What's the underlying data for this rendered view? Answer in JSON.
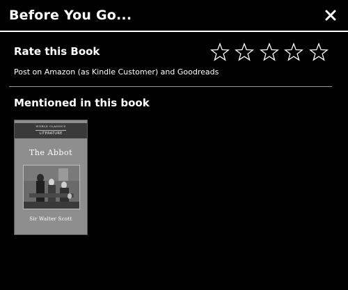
{
  "header": {
    "title": "Before You Go...",
    "close_icon": "close-x-icon"
  },
  "rating": {
    "title": "Rate this Book",
    "subtitle": "Post on Amazon (as Kindle Customer) and Goodreads",
    "max_stars": 5,
    "selected_stars": 0,
    "star_icon": "star-outline-icon"
  },
  "mentioned": {
    "title": "Mentioned in this book",
    "books": [
      {
        "cover_series": "WORLD CLASSICS",
        "cover_category": "LITERATURE",
        "cover_title": "The Abbot",
        "cover_author": "Sir Walter Scott"
      }
    ]
  },
  "colors": {
    "background": "#000000",
    "text": "#ffffff",
    "divider": "#9a9a9a",
    "cover": "#8e8e8e"
  }
}
